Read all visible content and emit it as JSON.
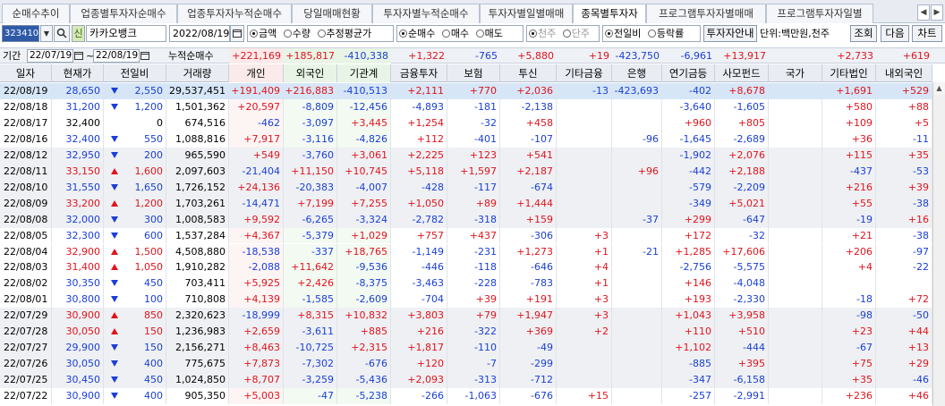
{
  "tabs": [
    "순매수추이",
    "업종별투자자순매수",
    "업종투자자누적순매수",
    "당일매매현황",
    "투자자별누적순매수",
    "투자자별일별매매",
    "종목별투자자",
    "프로그램투자자별매매",
    "프로그램투자자일별"
  ],
  "active_tab": 6,
  "toolbar": {
    "code": "323410",
    "stock_name": "카카오뱅크",
    "base_date": "2022/08/19",
    "unit_group": [
      "금액",
      "수량",
      "추정평균가"
    ],
    "trade_group": [
      "순매수",
      "매수",
      "매도"
    ],
    "unit_basis_group": [
      "천주",
      "단주"
    ],
    "ratio_group": [
      "전일비",
      "등락률"
    ],
    "investor_guide_label": "투자자안내",
    "unit_label": "단위:백만원,천주",
    "query_label": "조회",
    "next_label": "다음",
    "chart_label": "차트",
    "shin_label": "신"
  },
  "period": {
    "label": "기간",
    "from": "22/07/19",
    "to": "22/08/19",
    "cum_label": "누적순매수",
    "sums": [
      "+221,169",
      "+185,817",
      "-410,338",
      "+1,322",
      "-765",
      "+5,880",
      "+19",
      "-423,750",
      "-6,961",
      "+13,917",
      "",
      "+2,733",
      "+619"
    ]
  },
  "columns": [
    "일자",
    "현재가",
    "전일비",
    "거래량",
    "개인",
    "외국인",
    "기관계",
    "금융투자",
    "보험",
    "투신",
    "기타금융",
    "은행",
    "연기금등",
    "사모펀드",
    "국가",
    "기타법인",
    "내외국인"
  ],
  "rows": [
    {
      "date": "22/08/19",
      "price": "28,650",
      "dir": "dn",
      "chg": "2,550",
      "vol": "29,537,451",
      "v": [
        "+191,409",
        "+216,883",
        "-410,513",
        "+2,111",
        "+770",
        "+2,036",
        "-13",
        "-423,693",
        "-402",
        "+8,678",
        "",
        "+1,691",
        "+529"
      ]
    },
    {
      "date": "22/08/18",
      "price": "31,200",
      "dir": "dn",
      "chg": "1,200",
      "vol": "1,501,362",
      "v": [
        "+20,597",
        "-8,809",
        "-12,456",
        "-4,893",
        "-181",
        "-2,138",
        "",
        "",
        "-3,640",
        "-1,605",
        "",
        "+580",
        "+88"
      ]
    },
    {
      "date": "22/08/17",
      "price": "32,400",
      "dir": "",
      "chg": "0",
      "vol": "674,516",
      "v": [
        "-462",
        "-3,097",
        "+3,445",
        "+1,254",
        "-32",
        "+458",
        "",
        "",
        "+960",
        "+805",
        "",
        "+109",
        "+5"
      ]
    },
    {
      "date": "22/08/16",
      "price": "32,400",
      "dir": "dn",
      "chg": "550",
      "vol": "1,088,816",
      "v": [
        "+7,917",
        "-3,116",
        "-4,826",
        "+112",
        "-401",
        "-107",
        "",
        "-96",
        "-1,645",
        "-2,689",
        "",
        "+36",
        "-11"
      ]
    },
    {
      "date": "22/08/12",
      "price": "32,950",
      "dir": "dn",
      "chg": "200",
      "vol": "965,590",
      "v": [
        "+549",
        "-3,760",
        "+3,061",
        "+2,225",
        "+123",
        "+541",
        "",
        "",
        "-1,902",
        "+2,076",
        "",
        "+115",
        "+35"
      ]
    },
    {
      "date": "22/08/11",
      "price": "33,150",
      "dir": "up",
      "chg": "1,600",
      "vol": "2,097,603",
      "v": [
        "-21,404",
        "+11,150",
        "+10,745",
        "+5,118",
        "+1,597",
        "+2,187",
        "",
        "+96",
        "-442",
        "+2,188",
        "",
        "-437",
        "-53"
      ]
    },
    {
      "date": "22/08/10",
      "price": "31,550",
      "dir": "dn",
      "chg": "1,650",
      "vol": "1,726,152",
      "v": [
        "+24,136",
        "-20,383",
        "-4,007",
        "-428",
        "-117",
        "-674",
        "",
        "",
        "-579",
        "-2,209",
        "",
        "+216",
        "+39"
      ]
    },
    {
      "date": "22/08/09",
      "price": "33,200",
      "dir": "up",
      "chg": "1,200",
      "vol": "1,703,261",
      "v": [
        "-14,471",
        "+7,199",
        "+7,255",
        "+1,050",
        "+89",
        "+1,444",
        "",
        "",
        "-349",
        "+5,021",
        "",
        "+55",
        "-38"
      ]
    },
    {
      "date": "22/08/08",
      "price": "32,000",
      "dir": "dn",
      "chg": "300",
      "vol": "1,008,583",
      "v": [
        "+9,592",
        "-6,265",
        "-3,324",
        "-2,782",
        "-318",
        "+159",
        "",
        "-37",
        "+299",
        "-647",
        "",
        "-19",
        "+16"
      ]
    },
    {
      "date": "22/08/05",
      "price": "32,300",
      "dir": "dn",
      "chg": "600",
      "vol": "1,537,284",
      "v": [
        "+4,367",
        "-5,379",
        "+1,029",
        "+757",
        "+437",
        "-306",
        "+3",
        "",
        "+172",
        "-32",
        "",
        "+21",
        "-38"
      ]
    },
    {
      "date": "22/08/04",
      "price": "32,900",
      "dir": "up",
      "chg": "1,500",
      "vol": "4,508,880",
      "v": [
        "-18,538",
        "-337",
        "+18,765",
        "-1,149",
        "-231",
        "+1,273",
        "+1",
        "-21",
        "+1,285",
        "+17,606",
        "",
        "+206",
        "-97"
      ]
    },
    {
      "date": "22/08/03",
      "price": "31,400",
      "dir": "up",
      "chg": "1,050",
      "vol": "1,910,282",
      "v": [
        "-2,088",
        "+11,642",
        "-9,536",
        "-446",
        "-118",
        "-646",
        "+4",
        "",
        "-2,756",
        "-5,575",
        "",
        "+4",
        "-22"
      ]
    },
    {
      "date": "22/08/02",
      "price": "30,350",
      "dir": "dn",
      "chg": "450",
      "vol": "703,411",
      "v": [
        "+5,925",
        "+2,426",
        "-8,375",
        "-3,463",
        "-228",
        "-783",
        "+1",
        "",
        "+146",
        "-4,048",
        "",
        "",
        ""
      ]
    },
    {
      "date": "22/08/01",
      "price": "30,800",
      "dir": "dn",
      "chg": "100",
      "vol": "710,808",
      "v": [
        "+4,139",
        "-1,585",
        "-2,609",
        "-704",
        "+39",
        "+191",
        "+3",
        "",
        "+193",
        "-2,330",
        "",
        "-18",
        "+72"
      ]
    },
    {
      "date": "22/07/29",
      "price": "30,900",
      "dir": "up",
      "chg": "850",
      "vol": "2,320,623",
      "v": [
        "-18,999",
        "+8,315",
        "+10,832",
        "+3,803",
        "+79",
        "+1,947",
        "+3",
        "",
        "+1,043",
        "+3,958",
        "",
        "-98",
        "-50"
      ]
    },
    {
      "date": "22/07/28",
      "price": "30,050",
      "dir": "up",
      "chg": "150",
      "vol": "1,236,983",
      "v": [
        "+2,659",
        "-3,611",
        "+885",
        "+216",
        "-322",
        "+369",
        "+2",
        "",
        "+110",
        "+510",
        "",
        "+23",
        "+44"
      ]
    },
    {
      "date": "22/07/27",
      "price": "29,900",
      "dir": "dn",
      "chg": "150",
      "vol": "2,156,271",
      "v": [
        "+8,463",
        "-10,725",
        "+2,315",
        "+1,817",
        "-110",
        "-49",
        "",
        "",
        "+1,102",
        "-444",
        "",
        "-67",
        "+13"
      ]
    },
    {
      "date": "22/07/26",
      "price": "30,050",
      "dir": "dn",
      "chg": "400",
      "vol": "775,675",
      "v": [
        "+7,873",
        "-7,302",
        "-676",
        "+120",
        "-7",
        "-299",
        "",
        "",
        "-885",
        "+395",
        "",
        "+75",
        "+29"
      ]
    },
    {
      "date": "22/07/25",
      "price": "30,450",
      "dir": "dn",
      "chg": "450",
      "vol": "1,024,850",
      "v": [
        "+8,707",
        "-3,259",
        "-5,436",
        "+2,093",
        "-313",
        "-712",
        "",
        "",
        "-347",
        "-6,158",
        "",
        "+35",
        "-46"
      ]
    },
    {
      "date": "22/07/22",
      "price": "30,900",
      "dir": "dn",
      "chg": "400",
      "vol": "905,350",
      "v": [
        "+5,003",
        "-47",
        "-5,238",
        "-266",
        "-1,063",
        "-676",
        "+15",
        "",
        "-257",
        "-2,991",
        "",
        "+236",
        "+46"
      ]
    }
  ],
  "colors": {
    "up": "#e0141c",
    "down": "#1a3fd6",
    "highlight": "#d6e6f7",
    "shade": "#eef0f3",
    "foreign_bg": "#e8f5e6",
    "indiv_bg": "#fbeaea",
    "inst_bg": "#e8f5e6"
  }
}
